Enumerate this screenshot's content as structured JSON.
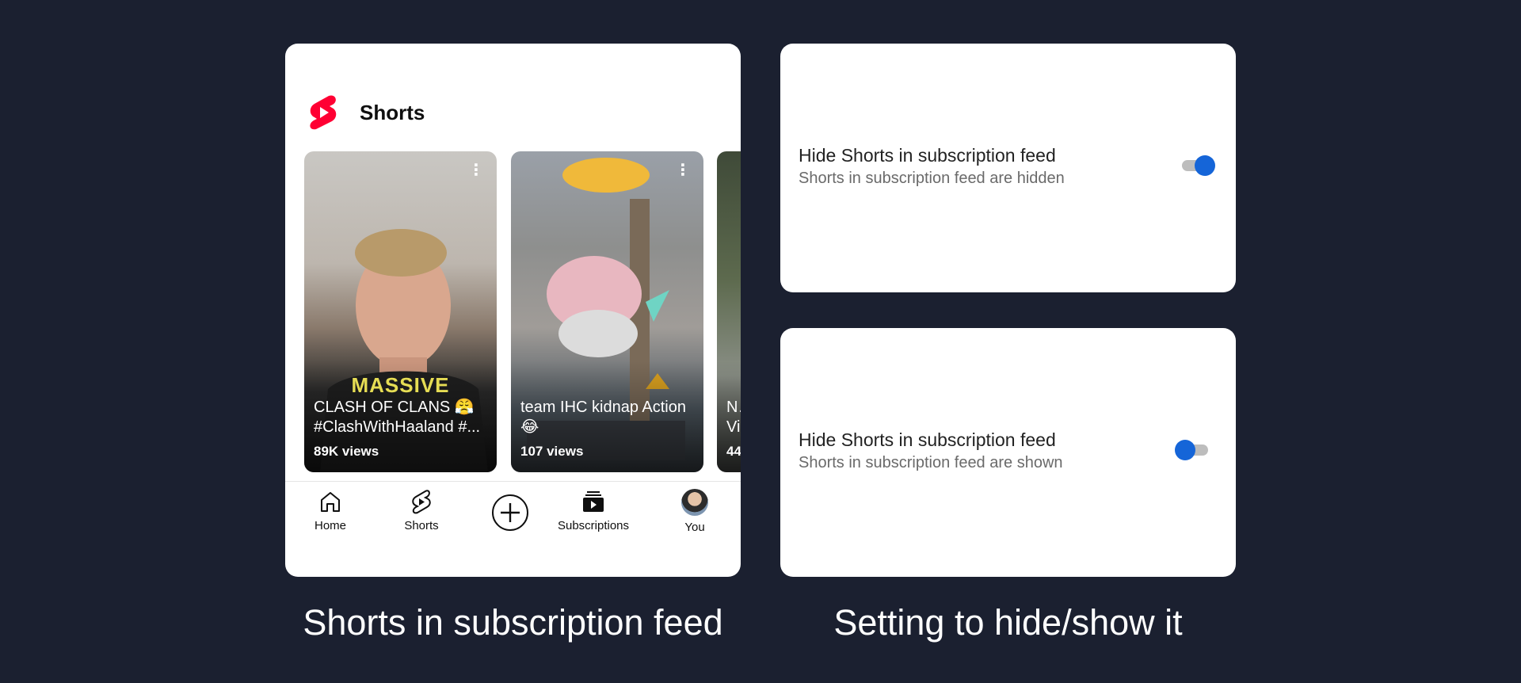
{
  "shorts_shelf": {
    "title": "Shorts",
    "logo_icon": "youtube-shorts-logo",
    "brand_color": "#ff0033",
    "items": [
      {
        "title": "CLASH OF CLANS 😤 #ClashWithHaaland #...",
        "views": "89K views",
        "overlay_text": "MASSIVE"
      },
      {
        "title": "team IHC kidnap Action 😂",
        "views": "107 views"
      },
      {
        "title": "N… Vi…",
        "views": "44…"
      }
    ]
  },
  "bottom_nav": {
    "home": "Home",
    "shorts": "Shorts",
    "create_icon": "plus-circle-icon",
    "subscriptions": "Subscriptions",
    "you": "You"
  },
  "settings": [
    {
      "title": "Hide Shorts in subscription feed",
      "subtitle": "Shorts in subscription feed are hidden",
      "enabled": true
    },
    {
      "title": "Hide Shorts in subscription feed",
      "subtitle": "Shorts in subscription feed are shown",
      "enabled": false
    }
  ],
  "toggle_color": "#1565d8",
  "captions": {
    "left": "Shorts in subscription feed",
    "right": "Setting  to hide/show it"
  }
}
